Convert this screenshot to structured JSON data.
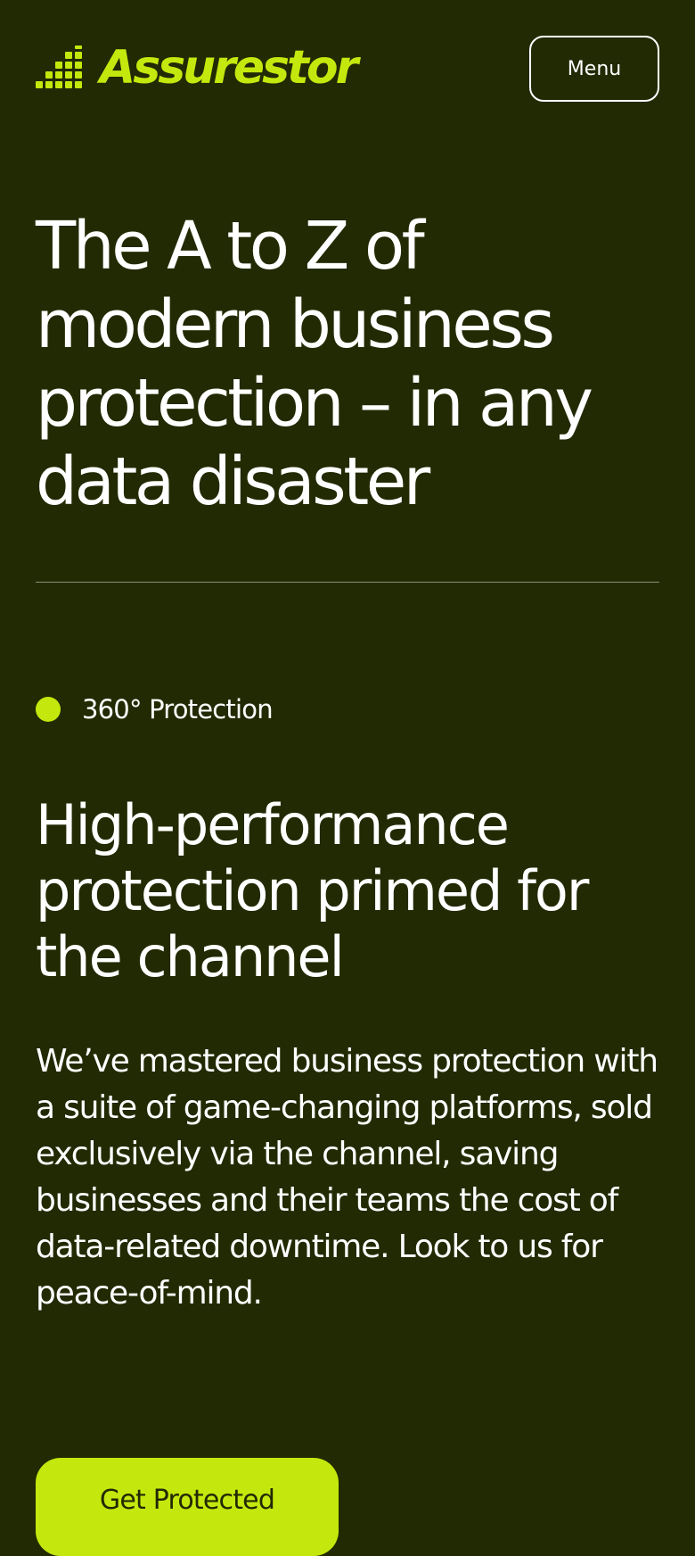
{
  "header": {
    "logo_text": "Assurestor",
    "menu_label": "Menu"
  },
  "hero": {
    "title": "The A to Z of modern business protection – in any data disaster"
  },
  "section": {
    "eyebrow": "360° Protection",
    "title": "High-performance protection primed for the channel",
    "body": "We’ve mastered business protection with a suite of game-changing platforms, sold exclusively via the channel, saving businesses and their teams the cost of data-related downtime. Look to us for peace-of-mind.",
    "cta_label": "Get Protected"
  },
  "colors": {
    "background": "#222a03",
    "accent": "#c4e80d",
    "text": "#ffffff"
  },
  "icons": {
    "logo": "stepped-dot-bars-logo-icon",
    "eyebrow": "dot-icon"
  }
}
